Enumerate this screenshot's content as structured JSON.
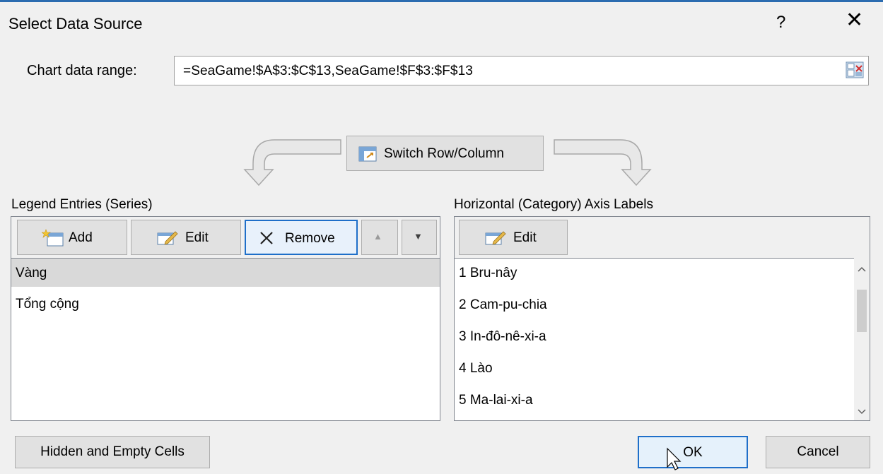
{
  "dialog": {
    "title": "Select Data Source",
    "help_label": "?",
    "close_label": "✕"
  },
  "range": {
    "label": "Chart data range:",
    "value": "=SeaGame!$A$3:$C$13,SeaGame!$F$3:$F$13"
  },
  "switch_button": {
    "label": "Switch Row/Column"
  },
  "legend": {
    "label": "Legend Entries (Series)",
    "buttons": {
      "add": "Add",
      "edit": "Edit",
      "remove": "Remove",
      "up": "▲",
      "down": "▼"
    },
    "items": [
      "Vàng",
      "Tổng cộng"
    ]
  },
  "axis": {
    "label": "Horizontal (Category) Axis Labels",
    "edit": "Edit",
    "items": [
      "1 Bru-nây",
      "2 Cam-pu-chia",
      "3 In-đô-nê-xi-a",
      "4 Lào",
      "5 Ma-lai-xi-a"
    ]
  },
  "footer": {
    "hidden_cells": "Hidden and Empty Cells",
    "ok": "OK",
    "cancel": "Cancel"
  },
  "colors": {
    "accent": "#1f6fc9",
    "selected_row": "#d9d9d9"
  }
}
